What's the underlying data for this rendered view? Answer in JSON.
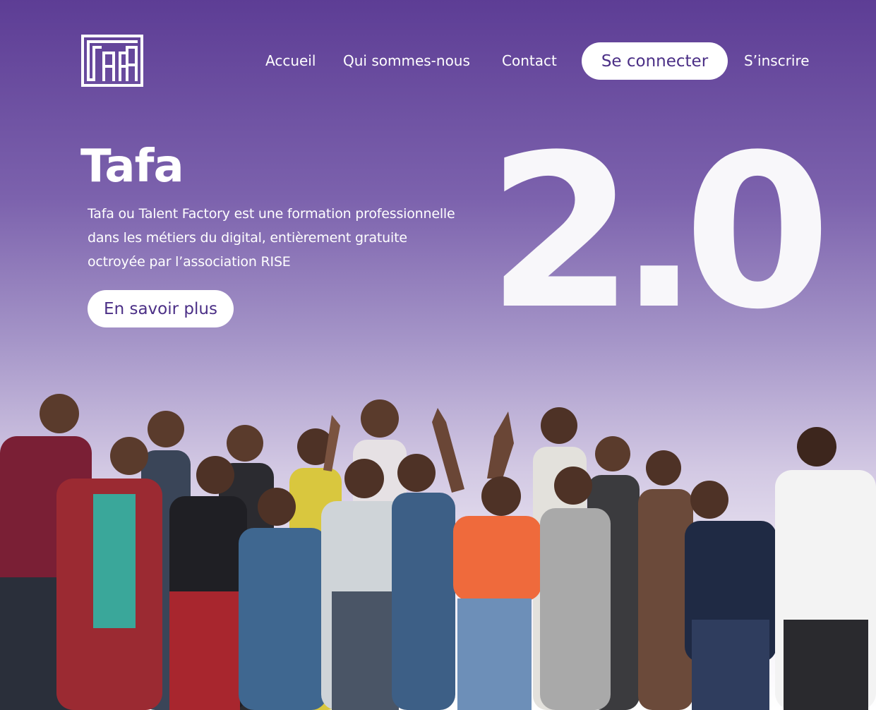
{
  "brand": {
    "logo_icon": "tafa-logo-icon",
    "logo_text": "TAFA"
  },
  "nav": {
    "items": [
      {
        "label": "Accueil"
      },
      {
        "label": "Qui sommes-nous"
      },
      {
        "label": "Contact"
      }
    ],
    "login_label": "Se connecter",
    "signup_label": "S’inscrire"
  },
  "hero": {
    "title": "Tafa",
    "description": "Tafa ou Talent Factory est une formation professionnelle dans les métiers du digital, entièrement gratuite octroyée par l’association RISE",
    "cta_label": "En savoir plus",
    "version": "2.0"
  },
  "colors": {
    "accent": "#5d3d95",
    "button_text": "#4b2f86",
    "background_top": "#5d3d95",
    "background_bottom": "#ffffff"
  }
}
